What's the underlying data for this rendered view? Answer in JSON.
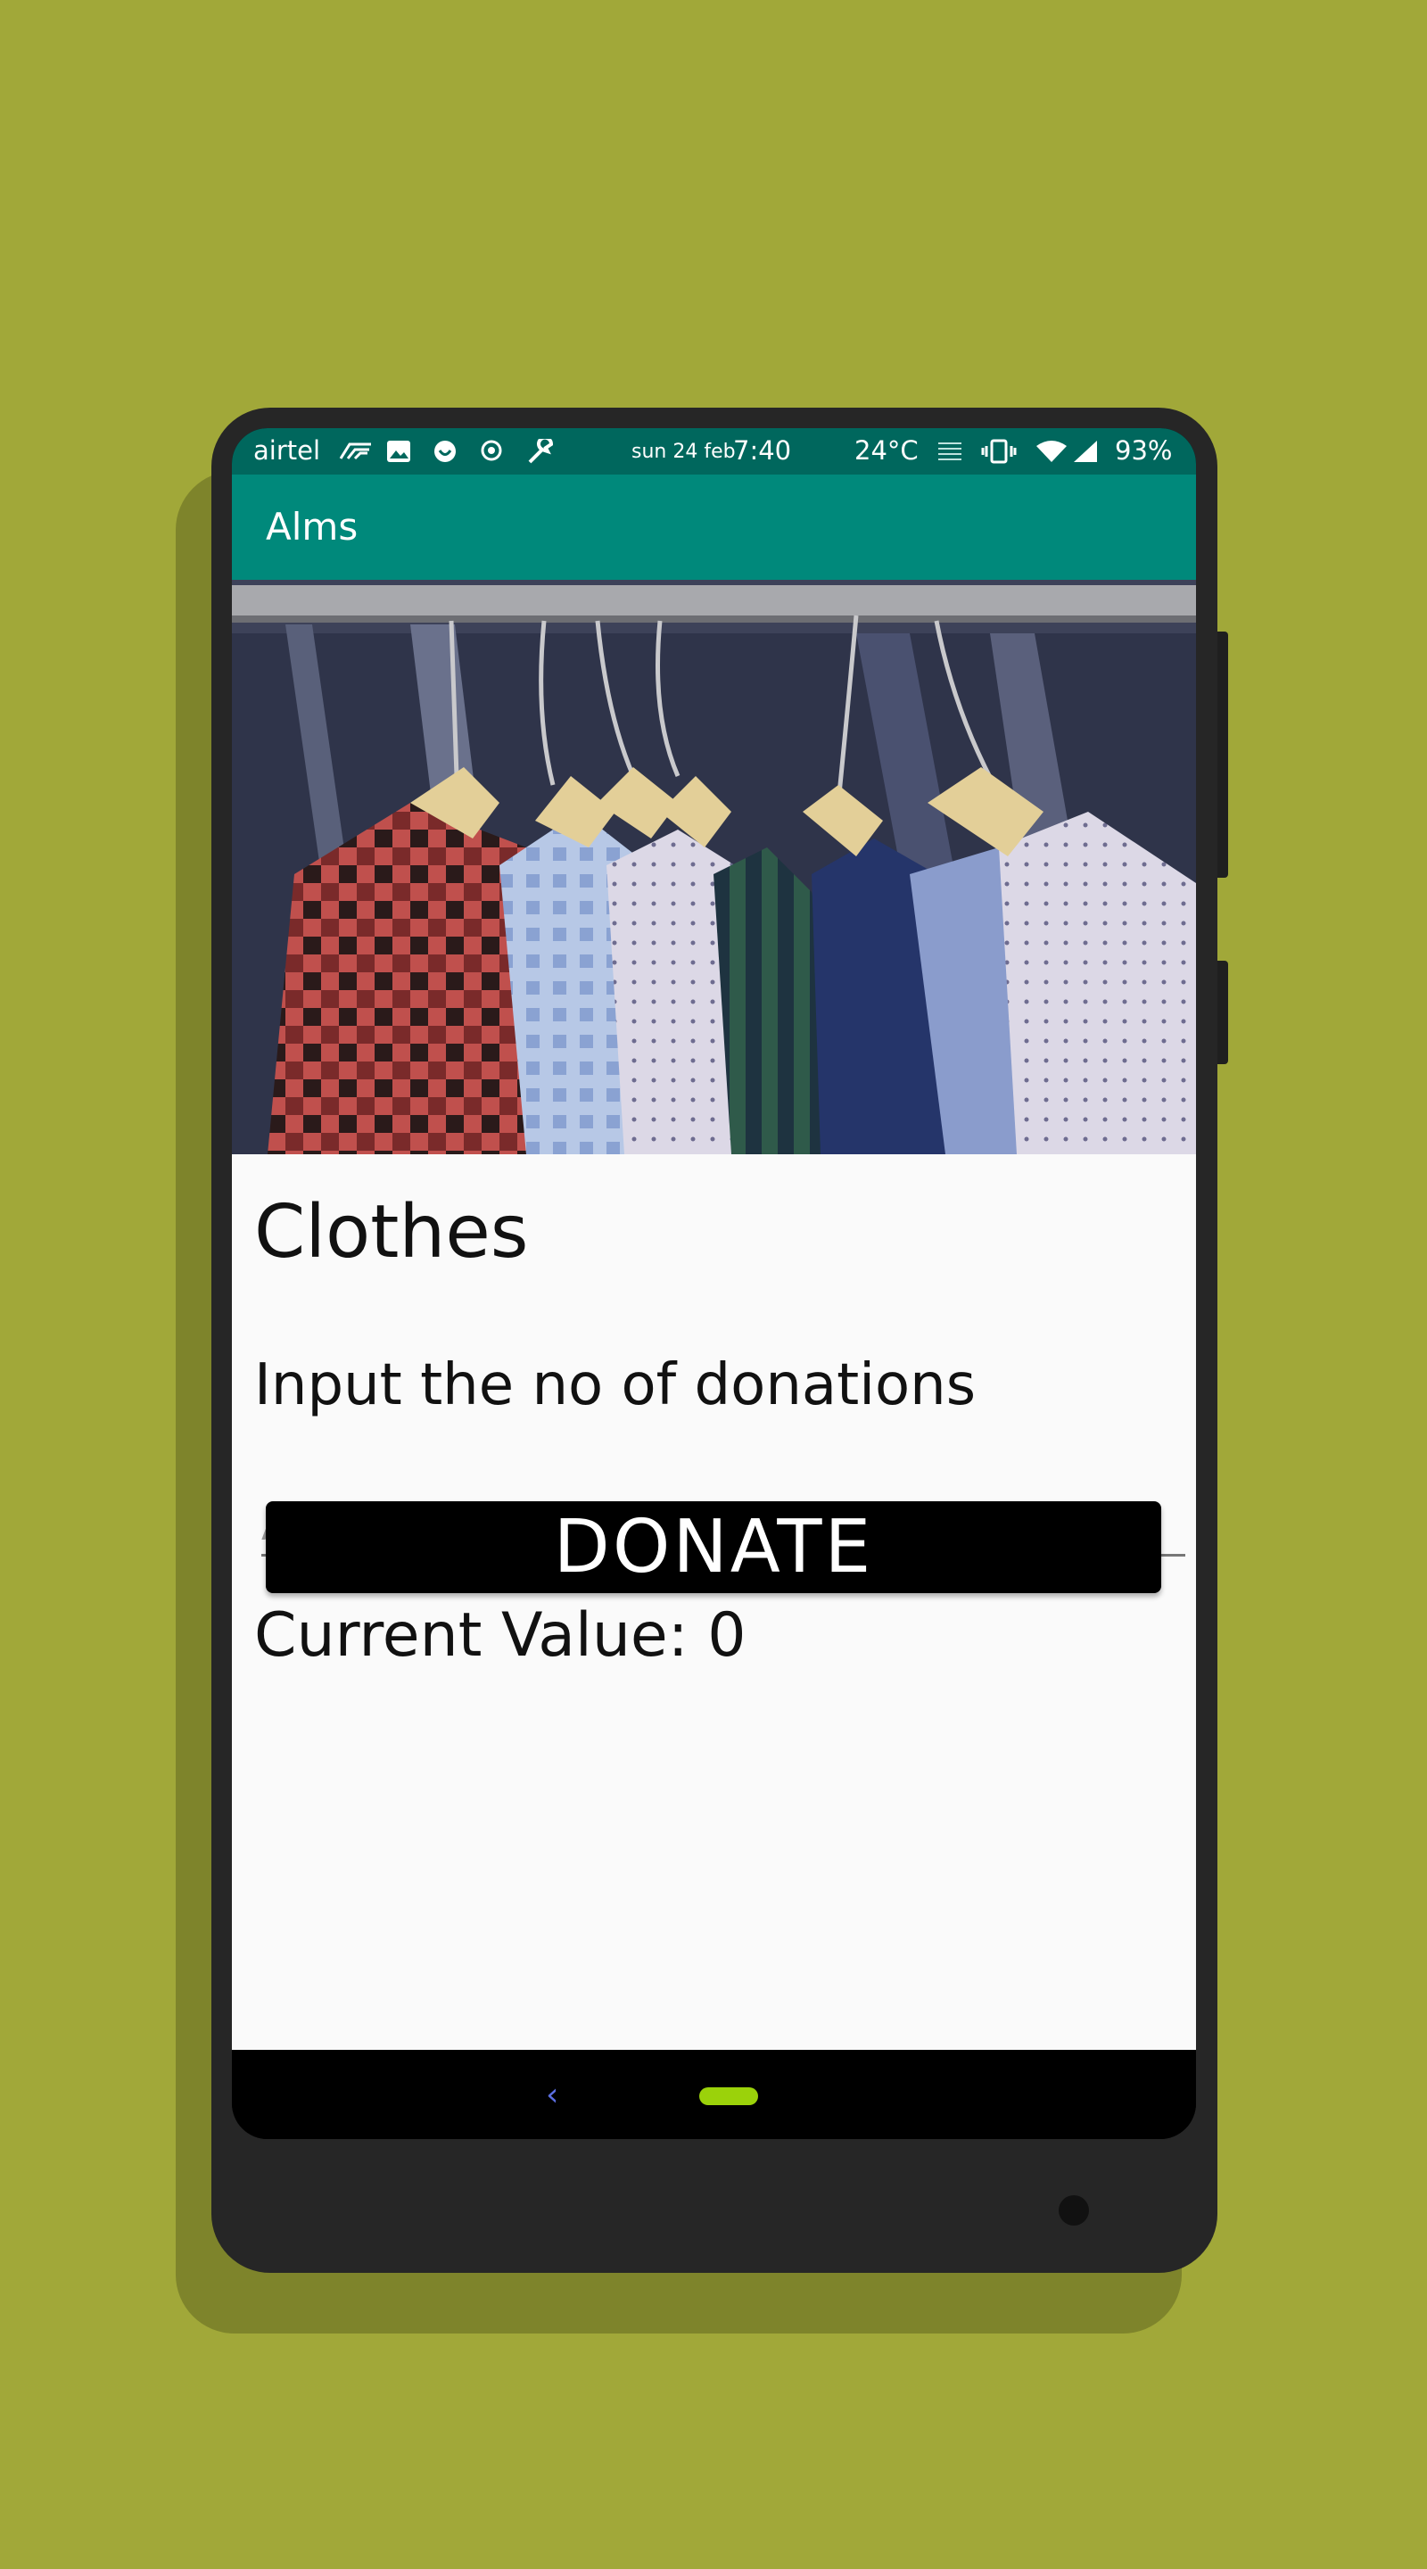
{
  "status_bar": {
    "carrier": "airtel",
    "date": "sun 24 feb",
    "time": "7:40",
    "temperature": "24°C",
    "battery": "93%",
    "icons": [
      "signal-wave-icon",
      "image-icon",
      "smile-icon",
      "badge-icon",
      "wrench-icon",
      "menu-lines-icon",
      "vibrate-icon",
      "wifi-icon",
      "cell-signal-icon"
    ]
  },
  "app_bar": {
    "title": "Alms"
  },
  "hero_image": {
    "description_icon": "clothes-rack-image"
  },
  "content": {
    "heading": "Clothes",
    "subheading": "Input the no of donations",
    "amount_placeholder": "Amount",
    "amount_value": "",
    "current_value_text": "Current Value: 0",
    "donate_label": "DONATE"
  },
  "nav_bar": {
    "back_icon": "chevron-left-icon",
    "home_icon": "home-pill-icon"
  },
  "colors": {
    "background": "#a1a839",
    "status_bar": "#00675d",
    "app_bar": "#00897b",
    "button": "#000000",
    "home_pill": "#9bd20a"
  }
}
